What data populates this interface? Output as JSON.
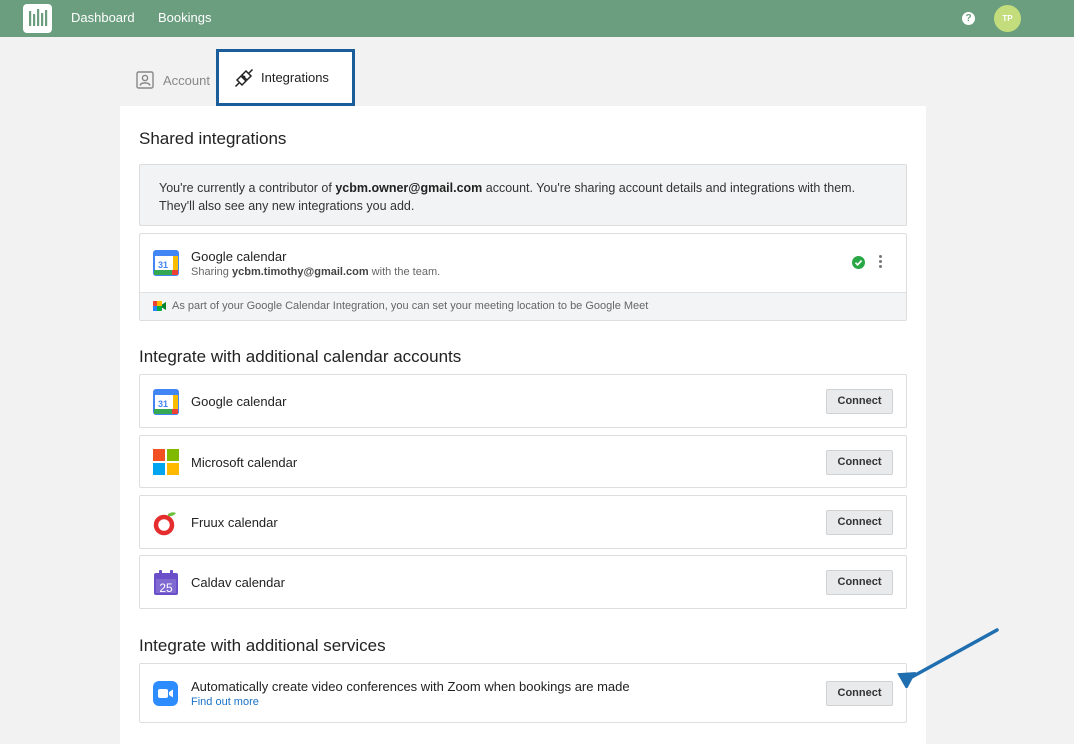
{
  "topbar": {
    "nav": [
      "Dashboard",
      "Bookings"
    ],
    "help_label": "?",
    "avatar_initials": "TP",
    "color": "#6a9e7f"
  },
  "tabs": {
    "account": "Account",
    "integrations": "Integrations"
  },
  "shared": {
    "title": "Shared integrations",
    "notice_pre": "You're currently a contributor of ",
    "notice_email": "ycbm.owner@gmail.com",
    "notice_post": " account. You're sharing account details and integrations with them. They'll also see any new integrations you add.",
    "card": {
      "name": "Google calendar",
      "sub_pre": "Sharing ",
      "sub_email": "ycbm.timothy@gmail.com",
      "sub_post": " with the team.",
      "footer": "As part of your Google Calendar Integration, you can set your meeting location to be Google Meet"
    }
  },
  "calendars": {
    "title": "Integrate with additional calendar accounts",
    "items": [
      {
        "name": "Google calendar",
        "button": "Connect"
      },
      {
        "name": "Microsoft calendar",
        "button": "Connect"
      },
      {
        "name": "Fruux calendar",
        "button": "Connect"
      },
      {
        "name": "Caldav calendar",
        "button": "Connect"
      }
    ]
  },
  "services": {
    "title": "Integrate with additional services",
    "zoom": {
      "name": "Automatically create video conferences with Zoom when bookings are made",
      "link": "Find out more",
      "button": "Connect"
    }
  },
  "icons": {
    "gcal_day": "31",
    "caldav_day": "25"
  }
}
